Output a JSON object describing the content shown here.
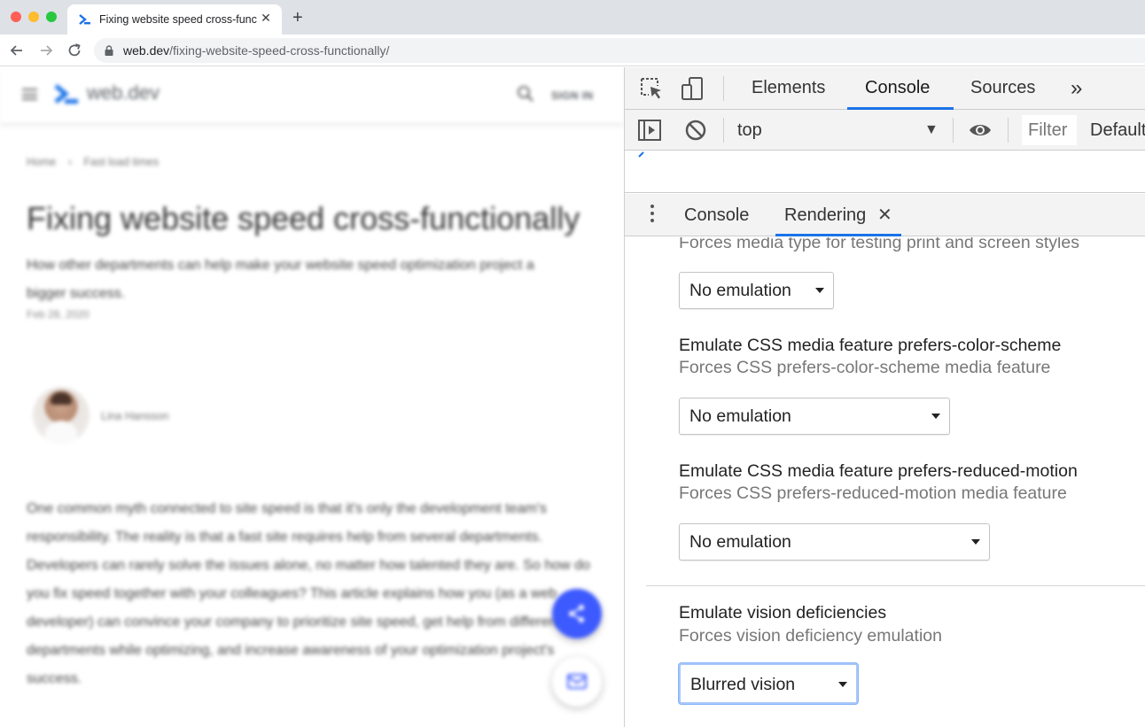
{
  "browser": {
    "tab_title": "Fixing website speed cross-functionally",
    "tab_close": "✕",
    "new_tab": "+",
    "url_host": "web.dev",
    "url_path": "/fixing-website-speed-cross-functionally/"
  },
  "page": {
    "logo_text": "web.dev",
    "sign_in": "SIGN IN",
    "breadcrumbs": [
      "Home",
      "›",
      "Fast load times"
    ],
    "title": "Fixing website speed cross-functionally",
    "subtitle": "How other departments can help make your website speed optimization project a bigger success.",
    "date": "Feb 28, 2020",
    "author": "Lina Hansson",
    "body": "One common myth connected to site speed is that it's only the development team's responsibility. The reality is that a fast site requires help from several departments. Developers can rarely solve the issues alone, no matter how talented they are. So how do you fix speed together with your colleagues? This article explains how you (as a web developer) can convince your company to prioritize site speed, get help from different departments while optimizing, and increase awareness of your optimization project's success."
  },
  "devtools": {
    "tabs": [
      "Elements",
      "Console",
      "Sources"
    ],
    "active_tab": "Console",
    "more_tabs": "»",
    "context": "top",
    "context_arrow": "▼",
    "filter_placeholder": "Filter",
    "levels": "Default levels",
    "drawer_tabs": [
      "Console",
      "Rendering"
    ],
    "drawer_active": "Rendering",
    "drawer_close": "✕",
    "rendering": {
      "media_type": {
        "desc": "Forces media type for testing print and screen styles",
        "value": "No emulation"
      },
      "color_scheme": {
        "title": "Emulate CSS media feature prefers-color-scheme",
        "desc": "Forces CSS prefers-color-scheme media feature",
        "value": "No emulation"
      },
      "reduced_motion": {
        "title": "Emulate CSS media feature prefers-reduced-motion",
        "desc": "Forces CSS prefers-reduced-motion media feature",
        "value": "No emulation"
      },
      "vision": {
        "title": "Emulate vision deficiencies",
        "desc": "Forces vision deficiency emulation",
        "value": "Blurred vision"
      }
    }
  },
  "colors": {
    "accent_blue": "#1a73e8",
    "fab_blue": "#3d5afe"
  }
}
